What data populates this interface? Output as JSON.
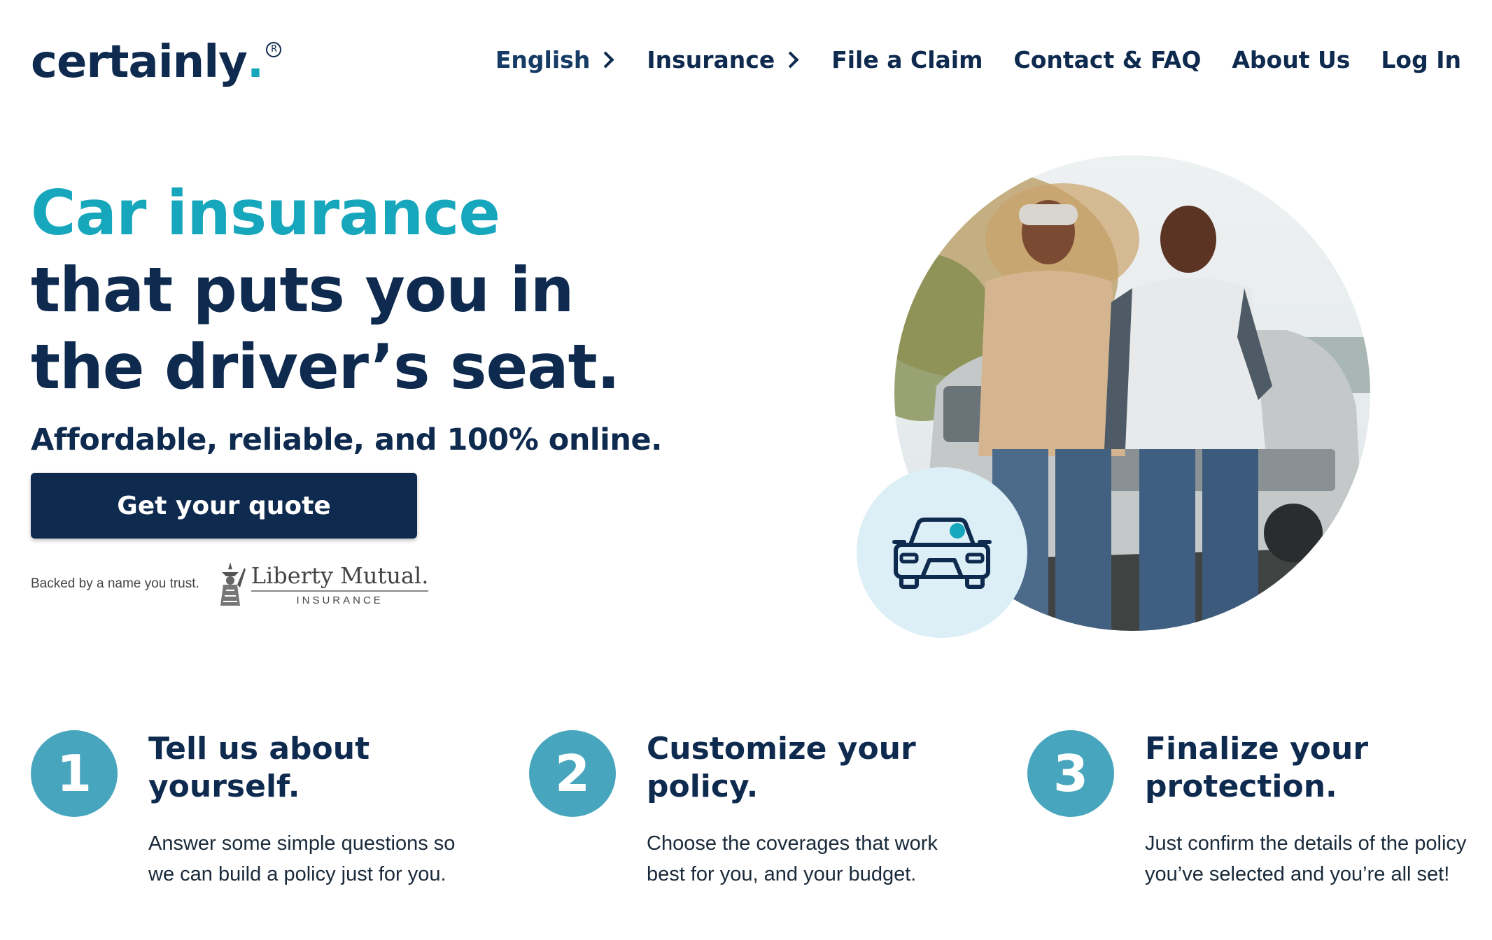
{
  "brand": {
    "name": "certainly",
    "dot": ".",
    "reg": "R"
  },
  "nav": {
    "language": "English",
    "insurance": "Insurance",
    "claim": "File a Claim",
    "contact": "Contact & FAQ",
    "about": "About Us",
    "login": "Log In"
  },
  "hero": {
    "title_accent": "Car insurance",
    "title_line2": "that puts you in",
    "title_line3": "the driver’s seat.",
    "subtitle": "Affordable, reliable, and 100% online.",
    "cta": "Get your quote",
    "backed_text": "Backed by a name you trust.",
    "partner_name": "Liberty Mutual.",
    "partner_sub": "INSURANCE"
  },
  "steps": [
    {
      "number": "1",
      "title": "Tell us about yourself.",
      "description": "Answer some simple questions so we can build a policy just for you."
    },
    {
      "number": "2",
      "title": "Customize your policy.",
      "description": "Choose the coverages that work best for you, and your budget."
    },
    {
      "number": "3",
      "title": "Finalize your protection.",
      "description": "Just confirm the details of the policy you’ve selected and you’re all set!"
    }
  ],
  "colors": {
    "navy": "#0e2a4e",
    "teal": "#16a7bd",
    "step_circle": "#47a6bd",
    "badge_bg": "#dceff6"
  }
}
